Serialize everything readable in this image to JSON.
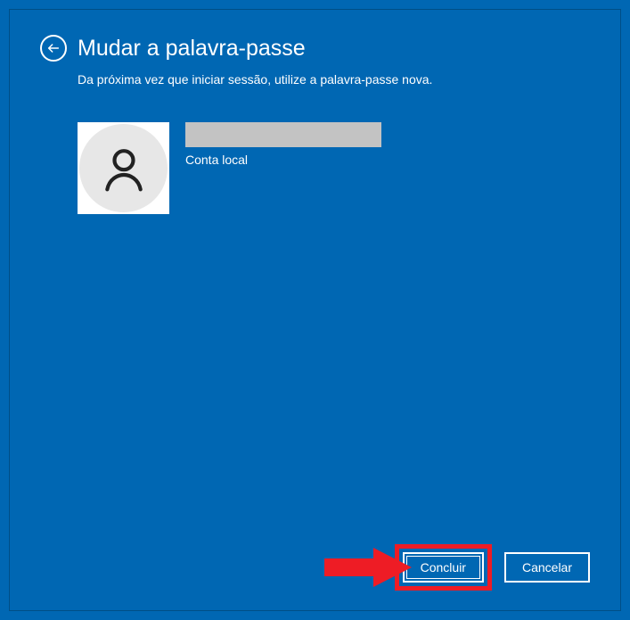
{
  "header": {
    "title": "Mudar a palavra-passe",
    "subtitle": "Da próxima vez que iniciar sessão, utilize a palavra-passe nova."
  },
  "user": {
    "account_type": "Conta local"
  },
  "footer": {
    "primary_button": "Concluir",
    "cancel_button": "Cancelar"
  },
  "colors": {
    "background": "#0067B3",
    "highlight": "#ee1c25",
    "text": "#ffffff"
  }
}
